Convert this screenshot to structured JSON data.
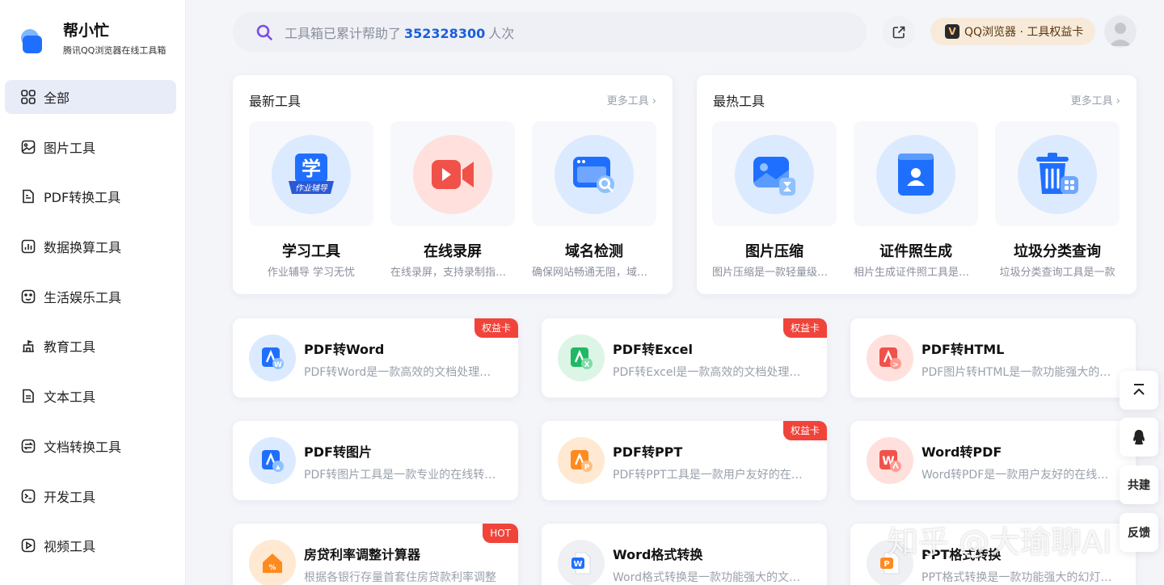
{
  "brand": {
    "title": "帮小忙",
    "subtitle": "腾讯QQ浏览器在线工具箱"
  },
  "sidebar": {
    "items": [
      {
        "label": "全部",
        "icon": "grid-icon"
      },
      {
        "label": "图片工具",
        "icon": "image-icon"
      },
      {
        "label": "PDF转换工具",
        "icon": "pdf-icon"
      },
      {
        "label": "数据换算工具",
        "icon": "chart-icon"
      },
      {
        "label": "生活娱乐工具",
        "icon": "life-icon"
      },
      {
        "label": "教育工具",
        "icon": "school-icon"
      },
      {
        "label": "文本工具",
        "icon": "text-icon"
      },
      {
        "label": "文档转换工具",
        "icon": "doc-convert-icon"
      },
      {
        "label": "开发工具",
        "icon": "terminal-icon"
      },
      {
        "label": "视频工具",
        "icon": "video-icon"
      }
    ]
  },
  "header": {
    "search_prefix": "工具箱已累计帮助了",
    "search_count": "352328300",
    "search_suffix": "人次",
    "promo_label": "QQ浏览器 · 工具权益卡",
    "promo_v": "V"
  },
  "panels": {
    "latest": {
      "title": "最新工具",
      "more": "更多工具",
      "tools": [
        {
          "name": "学习工具",
          "desc": "作业辅导 学习无忧",
          "icon_text": "学",
          "ribbon_text": "作业辅导"
        },
        {
          "name": "在线录屏",
          "desc": "在线录屏，支持录制指定区域"
        },
        {
          "name": "域名检测",
          "desc": "确保网站畅通无阻，域名检测"
        }
      ]
    },
    "hot": {
      "title": "最热工具",
      "more": "更多工具",
      "tools": [
        {
          "name": "图片压缩",
          "desc": "图片压缩是一款轻量级的工具"
        },
        {
          "name": "证件照生成",
          "desc": "相片生成证件照工具是一款"
        },
        {
          "name": "垃圾分类查询",
          "desc": "垃圾分类查询工具是一款"
        }
      ]
    }
  },
  "tools": [
    {
      "title": "PDF转Word",
      "desc": "PDF转Word是一款高效的文档处理工具",
      "badge": "权益卡",
      "letter": "W"
    },
    {
      "title": "PDF转Excel",
      "desc": "PDF转Excel是一款高效的文档处理工具",
      "badge": "权益卡",
      "letter": "X"
    },
    {
      "title": "PDF转HTML",
      "desc": "PDF图片转HTML是一款功能强大的工具",
      "badge": "",
      "letter": ">"
    },
    {
      "title": "PDF转图片",
      "desc": "PDF转图片工具是一款专业的在线转换工具",
      "badge": "",
      "letter": "▲"
    },
    {
      "title": "PDF转PPT",
      "desc": "PDF转PPT工具是一款用户友好的在线工具",
      "badge": "权益卡",
      "letter": "P"
    },
    {
      "title": "Word转PDF",
      "desc": "Word转PDF是一款用户友好的在线工具",
      "badge": "",
      "letter": "W"
    },
    {
      "title": "房贷利率调整计算器",
      "desc": "根据各银行存量首套住房贷款利率调整",
      "badge": "HOT",
      "letter": "%"
    },
    {
      "title": "Word格式转换",
      "desc": "Word格式转换是一款功能强大的文档工具",
      "badge": "",
      "letter": "W"
    },
    {
      "title": "PPT格式转换",
      "desc": "PPT格式转换是一款功能强大的幻灯片工具",
      "badge": "",
      "letter": "P"
    }
  ],
  "float": {
    "cogroup": "共建",
    "feedback": "反馈"
  },
  "watermark": "知乎 @大瑜聊AI",
  "colors": {
    "accent": "#1a5fd8",
    "badge": "#f0443a",
    "active_bg": "#e8ecf8"
  }
}
